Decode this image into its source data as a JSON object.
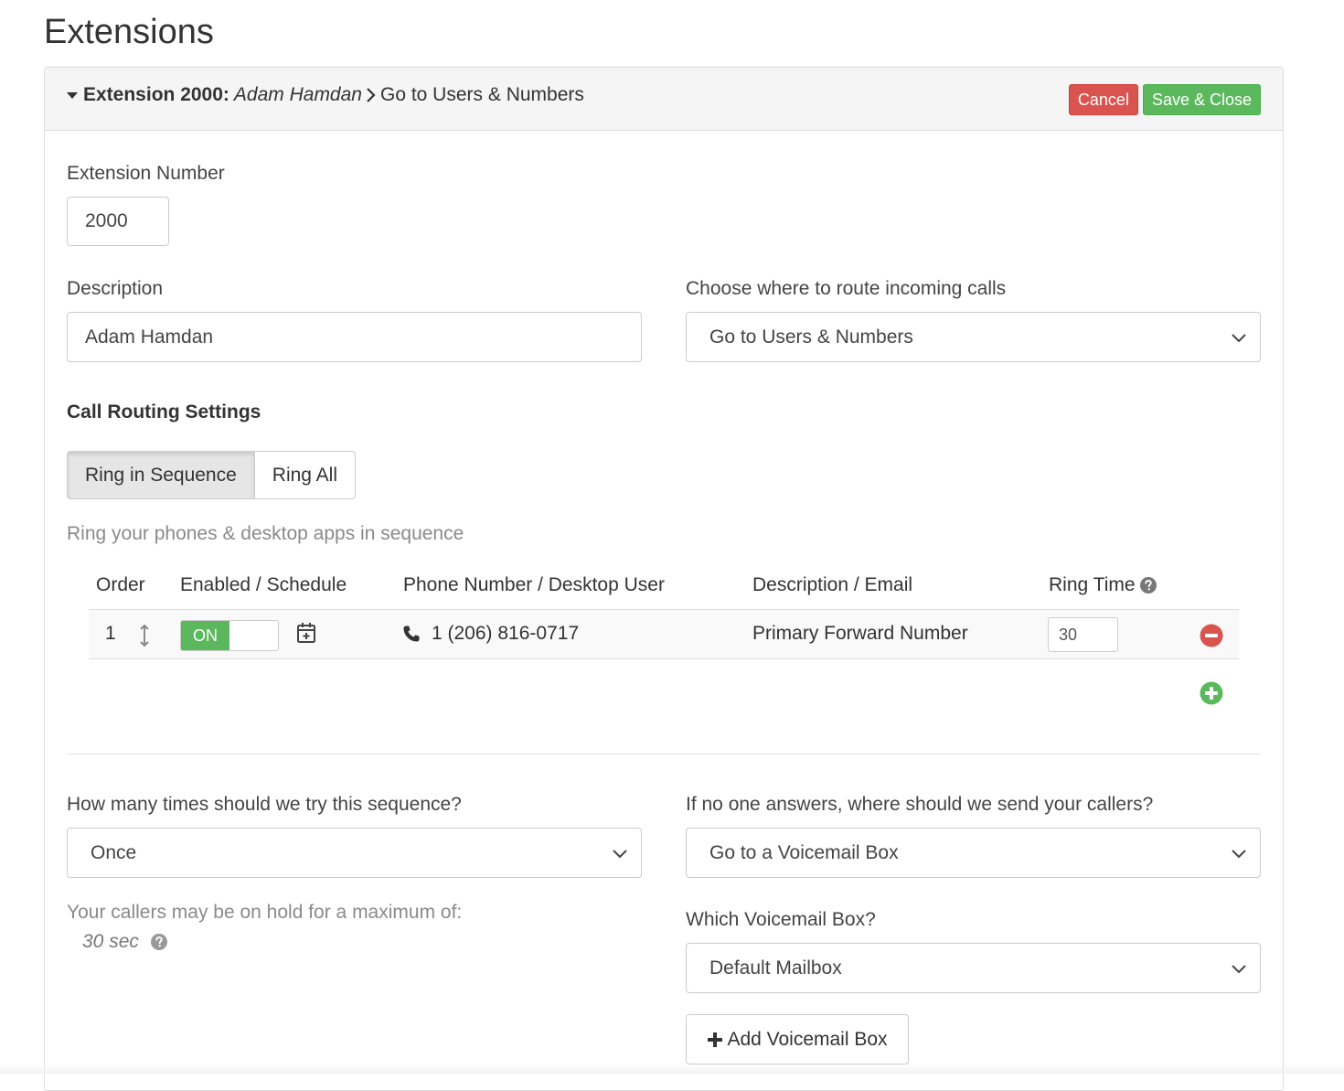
{
  "page": {
    "title": "Extensions"
  },
  "header": {
    "prefix": "Extension 2000:",
    "name": "Adam Hamdan",
    "route": "Go to Users & Numbers",
    "cancel_label": "Cancel",
    "save_label": "Save & Close"
  },
  "form": {
    "extension_number_label": "Extension Number",
    "extension_number_value": "2000",
    "description_label": "Description",
    "description_value": "Adam Hamdan",
    "route_label": "Choose where to route incoming calls",
    "route_value": "Go to Users & Numbers"
  },
  "call_routing": {
    "title": "Call Routing Settings",
    "modes": [
      {
        "label": "Ring in Sequence",
        "active": true
      },
      {
        "label": "Ring All",
        "active": false
      }
    ],
    "helper_text": "Ring your phones & desktop apps in sequence",
    "table": {
      "headers": {
        "order": "Order",
        "enabled": "Enabled / Schedule",
        "phone": "Phone Number / Desktop User",
        "description": "Description / Email",
        "ring_time": "Ring Time"
      },
      "rows": [
        {
          "order": "1",
          "enabled_label": "ON",
          "phone": "1 (206) 816-0717",
          "description": "Primary Forward Number",
          "ring_time": "30"
        }
      ]
    }
  },
  "sequence": {
    "tries_label": "How many times should we try this sequence?",
    "tries_value": "Once",
    "hold_label": "Your callers may be on hold for a maximum of:",
    "hold_value": "30 sec",
    "no_answer_label": "If no one answers, where should we send your callers?",
    "no_answer_value": "Go to a Voicemail Box",
    "voicemail_label": "Which Voicemail Box?",
    "voicemail_value": "Default Mailbox",
    "add_voicemail_label": "Add Voicemail Box"
  },
  "colors": {
    "danger": "#d9534f",
    "success": "#5cb85c"
  },
  "icons": {
    "collapse": "caret-down-icon",
    "chevron": "chevron-right-icon",
    "sort": "sort-vertical-icon",
    "schedule": "calendar-plus-icon",
    "phone": "phone-icon",
    "help": "question-circle-icon",
    "remove": "minus-circle-icon",
    "add": "plus-circle-icon"
  }
}
